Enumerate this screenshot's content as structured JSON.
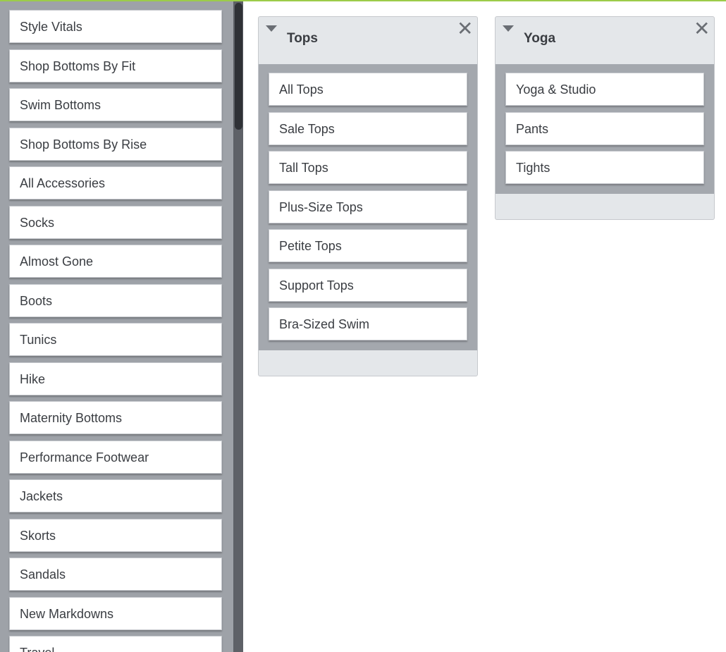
{
  "colors": {
    "accent_bar": "#9ccc4a",
    "sidebar_bg": "#9ea2a8",
    "panel_bg": "#e4e7ea",
    "panel_body_bg": "#a4a8ae",
    "scroll_thumb": "#2f3136"
  },
  "sidebar": {
    "items": [
      {
        "label": "Style Vitals"
      },
      {
        "label": "Shop Bottoms By Fit"
      },
      {
        "label": "Swim Bottoms"
      },
      {
        "label": "Shop Bottoms By Rise"
      },
      {
        "label": "All Accessories"
      },
      {
        "label": "Socks"
      },
      {
        "label": "Almost Gone"
      },
      {
        "label": "Boots"
      },
      {
        "label": "Tunics"
      },
      {
        "label": "Hike"
      },
      {
        "label": "Maternity Bottoms"
      },
      {
        "label": "Performance Footwear"
      },
      {
        "label": "Jackets"
      },
      {
        "label": "Skorts"
      },
      {
        "label": "Sandals"
      },
      {
        "label": "New Markdowns"
      },
      {
        "label": "Travel"
      }
    ]
  },
  "panels": [
    {
      "title": "Tops",
      "collapse_icon": "triangle-down-icon",
      "close_icon": "close-icon",
      "close_glyph": "✕",
      "items": [
        {
          "label": "All Tops"
        },
        {
          "label": "Sale Tops"
        },
        {
          "label": "Tall Tops"
        },
        {
          "label": "Plus-Size Tops"
        },
        {
          "label": "Petite Tops"
        },
        {
          "label": "Support Tops"
        },
        {
          "label": "Bra-Sized Swim"
        }
      ]
    },
    {
      "title": "Yoga",
      "collapse_icon": "triangle-down-icon",
      "close_icon": "close-icon",
      "close_glyph": "✕",
      "items": [
        {
          "label": "Yoga & Studio"
        },
        {
          "label": "Pants"
        },
        {
          "label": "Tights"
        }
      ]
    }
  ]
}
